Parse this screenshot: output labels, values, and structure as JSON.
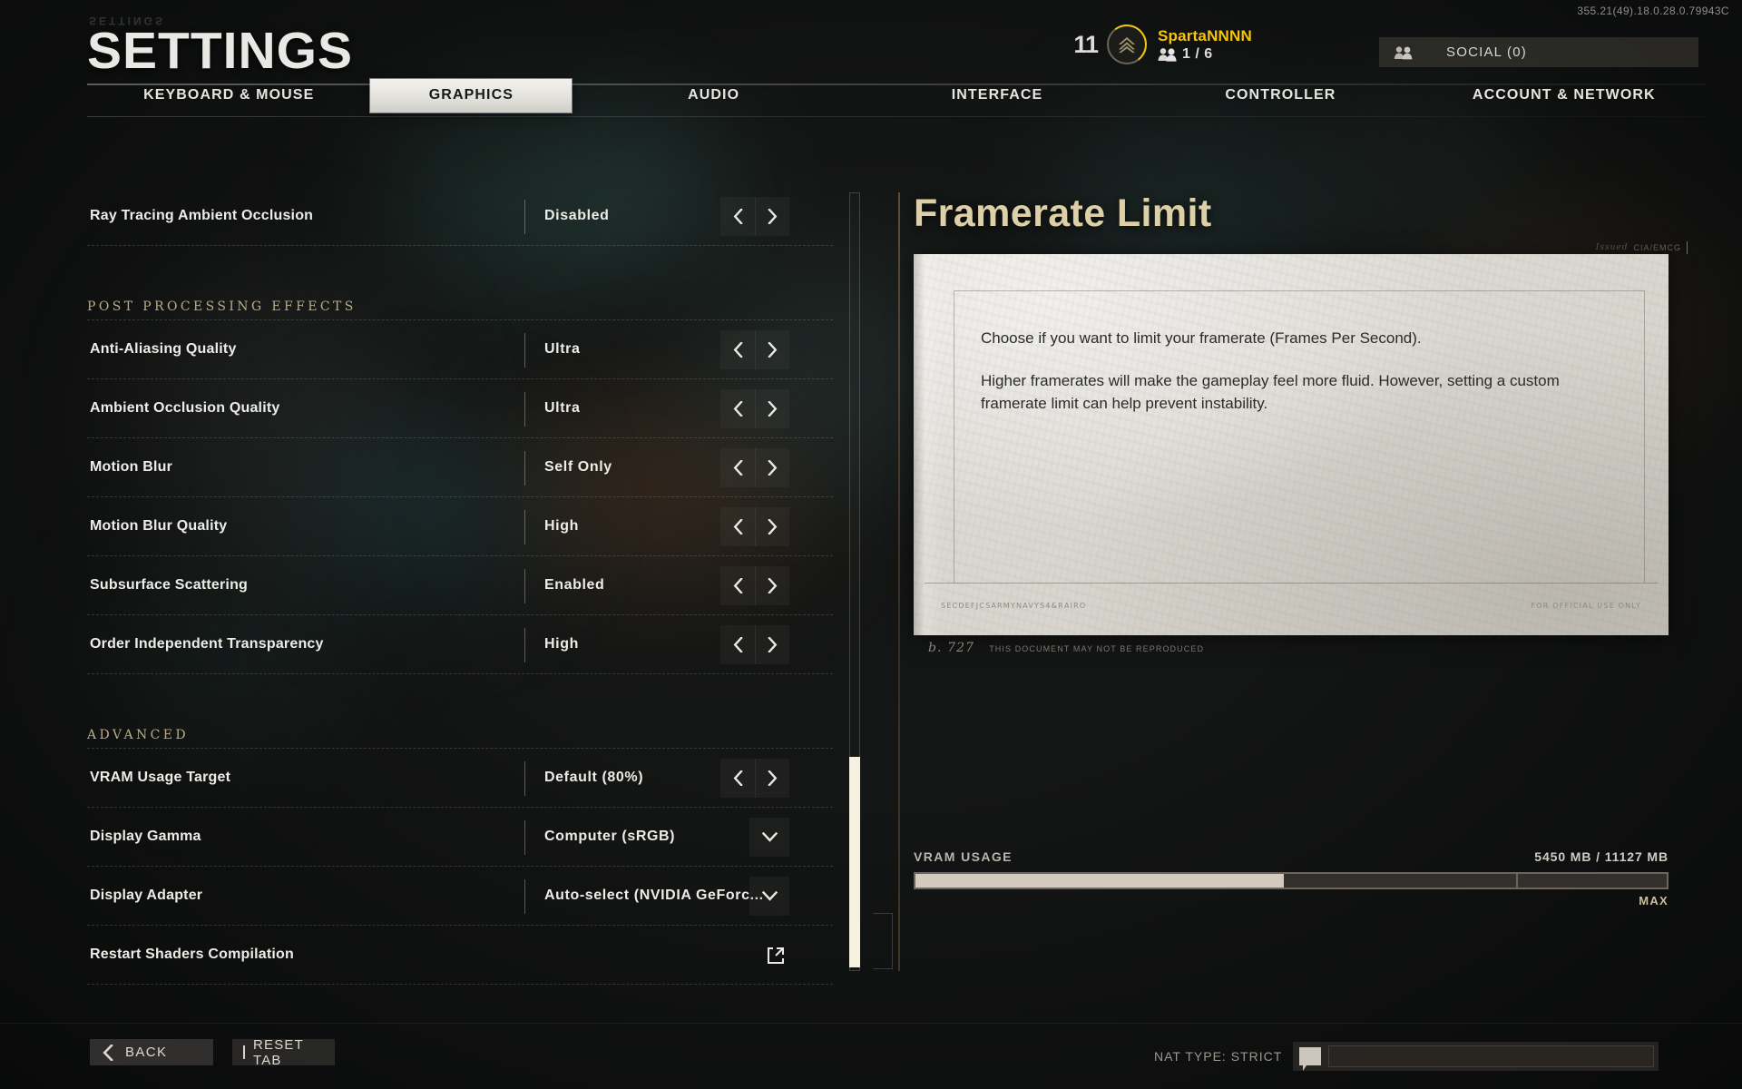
{
  "header": {
    "title": "SETTINGS",
    "ghost_title": "SETTINGS",
    "version": "355.21(49).18.0.28.0.79943C"
  },
  "user": {
    "level": "11",
    "rank_icon": "chevron-rank-icon",
    "name": "SpartaNNNN",
    "party_icon": "party-members-icon",
    "party": "1 / 6",
    "social_label": "SOCIAL (0)",
    "social_icon": "social-people-icon",
    "name_color": "#f5c40d",
    "level_ring_color": "#f0c40b"
  },
  "tabs": [
    {
      "label": "KEYBOARD & MOUSE",
      "selected": false
    },
    {
      "label": "GRAPHICS",
      "selected": true
    },
    {
      "label": "AUDIO",
      "selected": false
    },
    {
      "label": "INTERFACE",
      "selected": false
    },
    {
      "label": "CONTROLLER",
      "selected": false
    },
    {
      "label": "ACCOUNT & NETWORK",
      "selected": false
    }
  ],
  "settings": {
    "rows": [
      {
        "kind": "setting",
        "label": "Ray Tracing Ambient Occlusion",
        "value": "Disabled",
        "control": "arrows"
      },
      {
        "kind": "gap"
      },
      {
        "kind": "group",
        "label": "POST PROCESSING EFFECTS"
      },
      {
        "kind": "setting",
        "label": "Anti-Aliasing Quality",
        "value": "Ultra",
        "control": "arrows"
      },
      {
        "kind": "setting",
        "label": "Ambient Occlusion Quality",
        "value": "Ultra",
        "control": "arrows"
      },
      {
        "kind": "setting",
        "label": "Motion Blur",
        "value": "Self Only",
        "control": "arrows"
      },
      {
        "kind": "setting",
        "label": "Motion Blur Quality",
        "value": "High",
        "control": "arrows"
      },
      {
        "kind": "setting",
        "label": "Subsurface Scattering",
        "value": "Enabled",
        "control": "arrows"
      },
      {
        "kind": "setting",
        "label": "Order Independent Transparency",
        "value": "High",
        "control": "arrows"
      },
      {
        "kind": "gap"
      },
      {
        "kind": "group",
        "label": "ADVANCED"
      },
      {
        "kind": "setting",
        "label": "VRAM Usage Target",
        "value": "Default (80%)",
        "control": "arrows"
      },
      {
        "kind": "setting",
        "label": "Display Gamma",
        "value": "Computer (sRGB)",
        "control": "dropdown"
      },
      {
        "kind": "setting",
        "label": "Display Adapter",
        "value": "Auto-select (NVIDIA GeForc...",
        "control": "dropdown"
      },
      {
        "kind": "setting",
        "label": "Restart Shaders Compilation",
        "value": "",
        "control": "external"
      }
    ]
  },
  "detail": {
    "title": "Framerate Limit",
    "title_color": "#ddd0a8",
    "stamp_cursive": "Issued",
    "stamp_code": "CIA/EMCG",
    "paragraphs": [
      "Choose if you want to limit your framerate (Frames Per Second).",
      "Higher framerates will make the gameplay feel more fluid. However, setting a custom framerate limit can help prevent instability."
    ],
    "departments": [
      "SECDEF",
      "JCS",
      "ARMY",
      "NAVY",
      "S4&R",
      "AIRO"
    ],
    "classified_note": "FOR OFFICIAL USE ONLY",
    "footer_signature": "b. 727",
    "footer_note": "THIS DOCUMENT MAY NOT BE REPRODUCED"
  },
  "vram": {
    "label": "VRAM USAGE",
    "amount": "5450 MB / 11127 MB",
    "used_mb": 5450,
    "total_mb": 11127,
    "fill_percent": 49,
    "max_marker_percent": 80,
    "max_label": "MAX"
  },
  "footer": {
    "back_label": "BACK",
    "back_icon": "chevron-left-icon",
    "reset_label": "RESET TAB",
    "nat_type": "NAT TYPE: STRICT",
    "chat_icon": "chat-bubble-icon",
    "chat_placeholder": ""
  }
}
